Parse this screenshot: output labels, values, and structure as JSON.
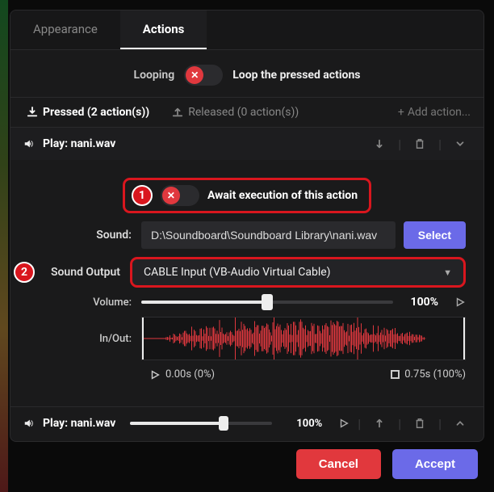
{
  "tabs": {
    "appearance": "Appearance",
    "actions": "Actions"
  },
  "looping": {
    "left_label": "Looping",
    "right_label": "Loop the pressed actions",
    "enabled": false
  },
  "subtabs": {
    "pressed_label": "Pressed (2 action(s))",
    "released_label": "Released (0 action(s))",
    "add_label": "Add action..."
  },
  "action1": {
    "header_title": "Play: nani.wav",
    "await_label": "Await execution of this action",
    "await_enabled": false,
    "sound_label": "Sound:",
    "sound_path": "D:\\Soundboard\\Soundboard Library\\nani.wav",
    "select_btn": "Select",
    "output_label": "Sound Output",
    "output_value": "CABLE Input (VB-Audio Virtual Cable)",
    "volume_label": "Volume:",
    "volume_pct": 50,
    "volume_text": "100%",
    "inout_label": "In/Out:",
    "in_text": "0.00s (0%)",
    "out_text": "0.75s (100%)"
  },
  "action2": {
    "title": "Play: nani.wav",
    "volume_pct": 66,
    "volume_text": "100%"
  },
  "annotations": {
    "badge1": "1",
    "badge2": "2"
  },
  "footer": {
    "cancel": "Cancel",
    "accept": "Accept"
  }
}
